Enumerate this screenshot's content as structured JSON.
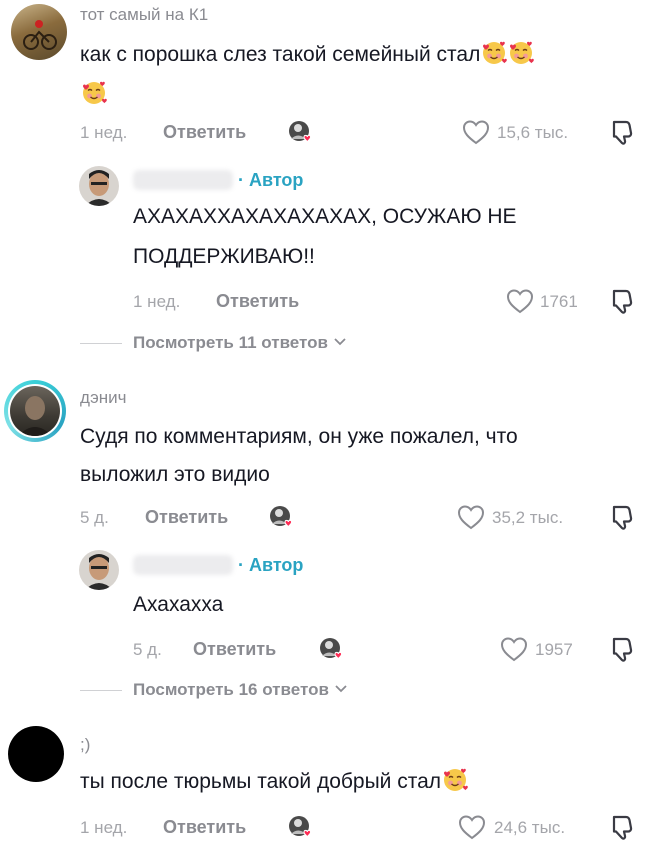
{
  "comments": [
    {
      "username": "тот самый на К1",
      "text": "как с порошка слез такой семейный стал",
      "time": "1 нед.",
      "reply_label": "Ответить",
      "likes": "15,6 тыс.",
      "avatar_icon": "moto-avatar",
      "emojis": 3,
      "replies": [
        {
          "tag": "· Автор",
          "text_line1": "АХАХАХХАХАХАХАХАХ, ОСУЖАЮ НЕ",
          "text_line2": "ПОДДЕРЖИВАЮ!!",
          "time": "1 нед.",
          "reply_label": "Ответить",
          "likes": "1761"
        }
      ],
      "view_replies": "Посмотреть 11 ответов"
    },
    {
      "username": "дэнич",
      "text_line1": "Судя по комментариям, он уже пожалел, что",
      "text_line2": "выложил это видио",
      "time": "5 д.",
      "reply_label": "Ответить",
      "likes": "35,2 тыс.",
      "replies": [
        {
          "tag": "· Автор",
          "text": "Ахахахха",
          "time": "5 д.",
          "reply_label": "Ответить",
          "likes": "1957"
        }
      ],
      "view_replies": "Посмотреть 16 ответов"
    },
    {
      "username": ";)",
      "text": "ты после тюрьмы такой добрый стал",
      "time": "1 нед.",
      "reply_label": "Ответить",
      "likes": "24,6 тыс."
    }
  ],
  "colors": {
    "author": "#2aa3c2",
    "meta": "#a4a5aa",
    "reply": "#8a8b91",
    "heart": "#fe2c55"
  },
  "icons": [
    "heart-outline-icon",
    "dislike-icon",
    "creator-like-badge-icon",
    "chevron-down-icon",
    "smiling-face-with-hearts-emoji"
  ]
}
